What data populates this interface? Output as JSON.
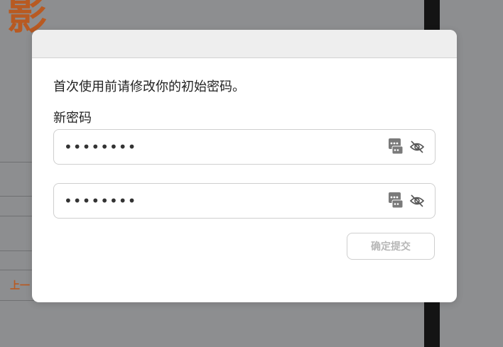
{
  "background": {
    "logo_glyph": "影",
    "prev_link_label": "上一"
  },
  "modal": {
    "intro_text": "首次使用前请修改你的初始密码。",
    "new_password_label": "新密码",
    "fields": [
      {
        "masked_value": "••••••••"
      },
      {
        "masked_value": "••••••••"
      }
    ],
    "submit_label": "确定提交"
  },
  "icons": {
    "password_manager": "password-manager-icon",
    "toggle_visibility": "eye-slash-icon"
  },
  "colors": {
    "brand": "#b85a22",
    "overlay": "#8d8e90",
    "disabled_text": "#b7b7b7"
  }
}
